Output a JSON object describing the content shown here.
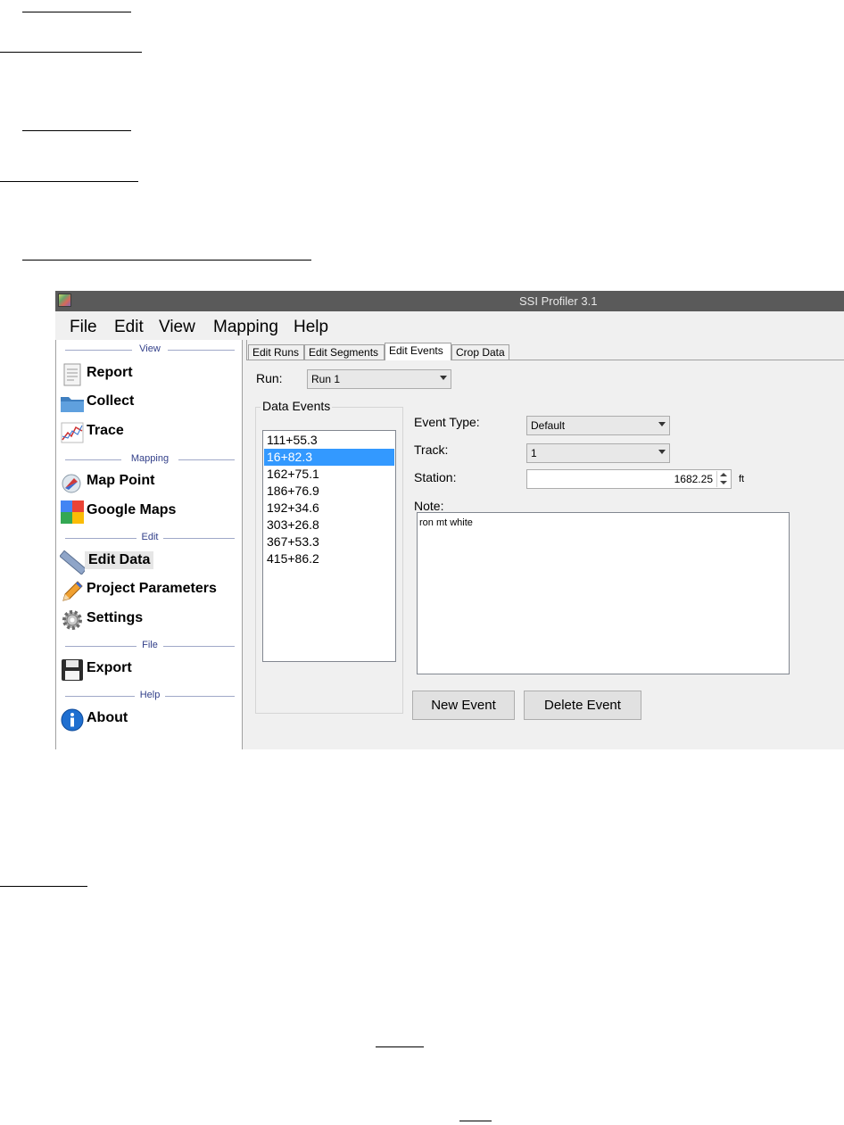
{
  "window": {
    "title": "SSI Profiler 3.1"
  },
  "menu": [
    "File",
    "Edit",
    "View",
    "Mapping",
    "Help"
  ],
  "sidebar": {
    "sections": [
      "View",
      "Mapping",
      "Edit",
      "File",
      "Help"
    ],
    "items": [
      {
        "label": "Report",
        "icon": "report-icon"
      },
      {
        "label": "Collect",
        "icon": "folder-icon"
      },
      {
        "label": "Trace",
        "icon": "chart-icon"
      },
      {
        "label": "Map Point",
        "icon": "compass-icon"
      },
      {
        "label": "Google Maps",
        "icon": "google-maps-icon"
      },
      {
        "label": "Edit Data",
        "icon": "ruler-icon"
      },
      {
        "label": "Project Parameters",
        "icon": "pencil-icon"
      },
      {
        "label": "Settings",
        "icon": "gear-icon"
      },
      {
        "label": "Export",
        "icon": "floppy-icon"
      },
      {
        "label": "About",
        "icon": "info-icon"
      }
    ],
    "active": "Edit Data"
  },
  "tabs": [
    "Edit Runs",
    "Edit Segments",
    "Edit Events",
    "Crop Data"
  ],
  "selected_tab": "Edit Events",
  "form": {
    "run_label": "Run:",
    "run_value": "Run 1",
    "data_events_title": "Data Events",
    "events": [
      "111+55.3",
      "16+82.3",
      "162+75.1",
      "186+76.9",
      "192+34.6",
      "303+26.8",
      "367+53.3",
      "415+86.2"
    ],
    "selected_event": "16+82.3",
    "event_type_label": "Event Type:",
    "event_type_value": "Default",
    "track_label": "Track:",
    "track_value": "1",
    "station_label": "Station:",
    "station_value": "1682.25",
    "station_unit": "ft",
    "note_label": "Note:",
    "note_value": "ron mt white",
    "new_event_label": "New Event",
    "delete_event_label": "Delete Event"
  },
  "colors": {
    "titlebar": "#5a5a5a",
    "selection": "#3399ff",
    "section_text": "#33408a"
  }
}
